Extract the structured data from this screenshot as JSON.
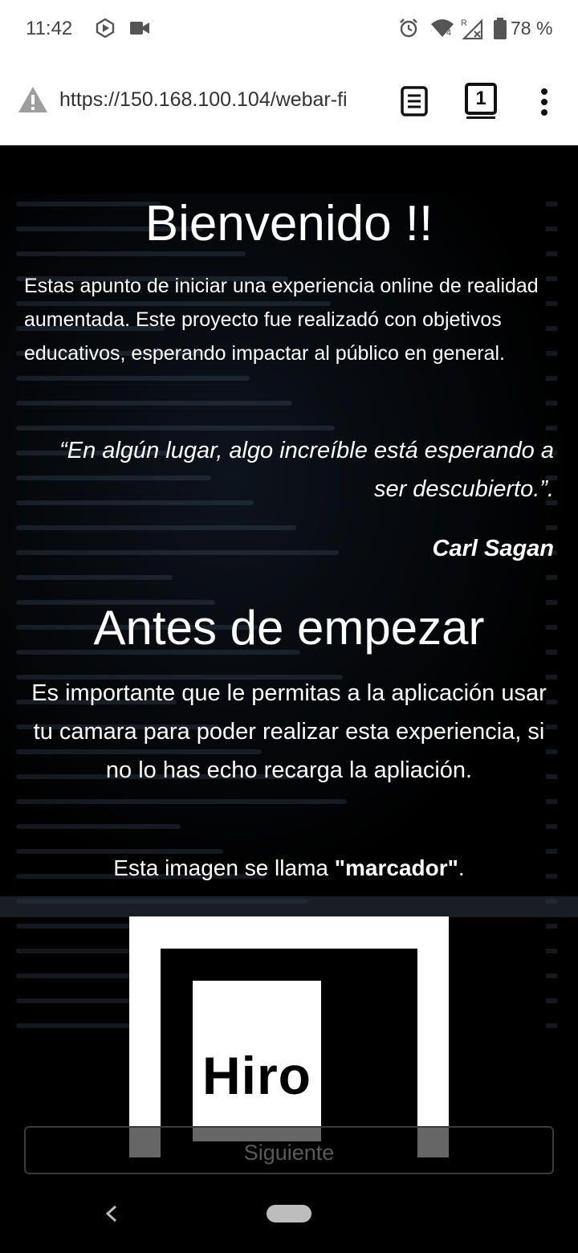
{
  "status_bar": {
    "time": "11:42",
    "battery": "78 %",
    "icons": [
      "play-circle-icon",
      "video-camera-icon",
      "alarm-icon",
      "wifi-icon",
      "signal-icon",
      "battery-icon"
    ]
  },
  "browser": {
    "url": "https://150.168.100.104/webar-fi",
    "tab_count": "1",
    "icons": [
      "warning-icon",
      "reader-mode-icon",
      "tabs-icon",
      "more-menu-icon"
    ]
  },
  "page": {
    "title": "Bienvenido !!",
    "intro": "Estas apunto de iniciar una experiencia online de realidad aumentada. Este proyecto fue realizadó con objetivos educativos, esperando impactar al público en general.",
    "quote": "“En algún lugar, algo increíble está esperando a ser descubierto.”.",
    "quote_author": "Carl Sagan",
    "section_title": "Antes de empezar",
    "section_text": "Es importante que le permitas a la aplicación usar tu camara para poder realizar esta experiencia, si no lo has echo recarga la apliación.",
    "marker_sentence_prefix": "Esta imagen se llama ",
    "marker_sentence_name": "\"marcador\"",
    "marker_sentence_suffix": ".",
    "marker_label": "Hiro",
    "next_button": "Siguiente"
  },
  "colors": {
    "background": "#000000",
    "text": "#ffffff",
    "button_border": "#3a3a3a",
    "button_text": "#5a5a5a"
  }
}
